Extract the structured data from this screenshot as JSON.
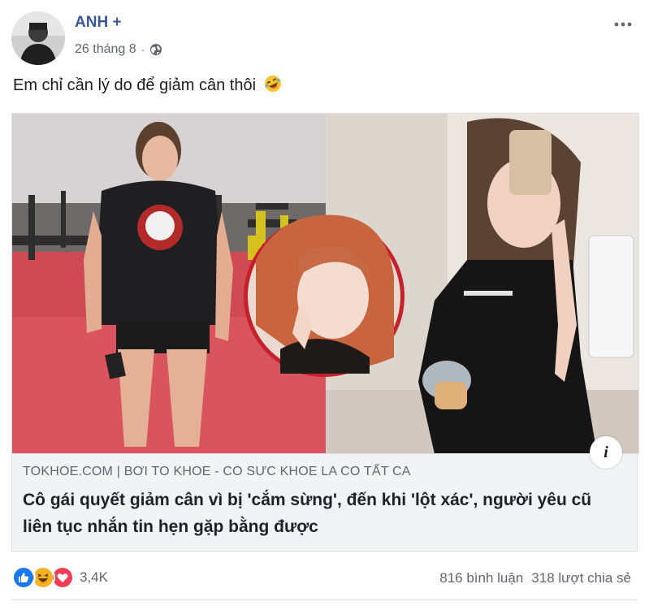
{
  "post": {
    "author": "ANH +",
    "date": "26 tháng 8",
    "date_separator": "·",
    "text": "Em chỉ cần lý do để giảm cân thôi",
    "text_emoji": "rofl-emoji"
  },
  "link_preview": {
    "domain": "TOKHOE.COM  |  BƠI TO KHOE - CO SƯC KHOE LA CO TẤT CA",
    "title": "Cô gái quyết giảm cân vì bị 'cắm sừng', đến khi 'lột xác', người yêu cũ liên tục nhắn tin hẹn gặp bằng được",
    "info_label": "i"
  },
  "stats": {
    "reaction_icons": [
      "like-icon",
      "haha-icon",
      "love-icon"
    ],
    "reaction_count": "3,4K",
    "comments": "816 bình luận",
    "shares": "318 lượt chia sẻ"
  },
  "colors": {
    "author": "#385898",
    "link_bg": "#f2f3f5",
    "like": "#1877f2",
    "love": "#f33e58",
    "haha": "#f7b125"
  }
}
